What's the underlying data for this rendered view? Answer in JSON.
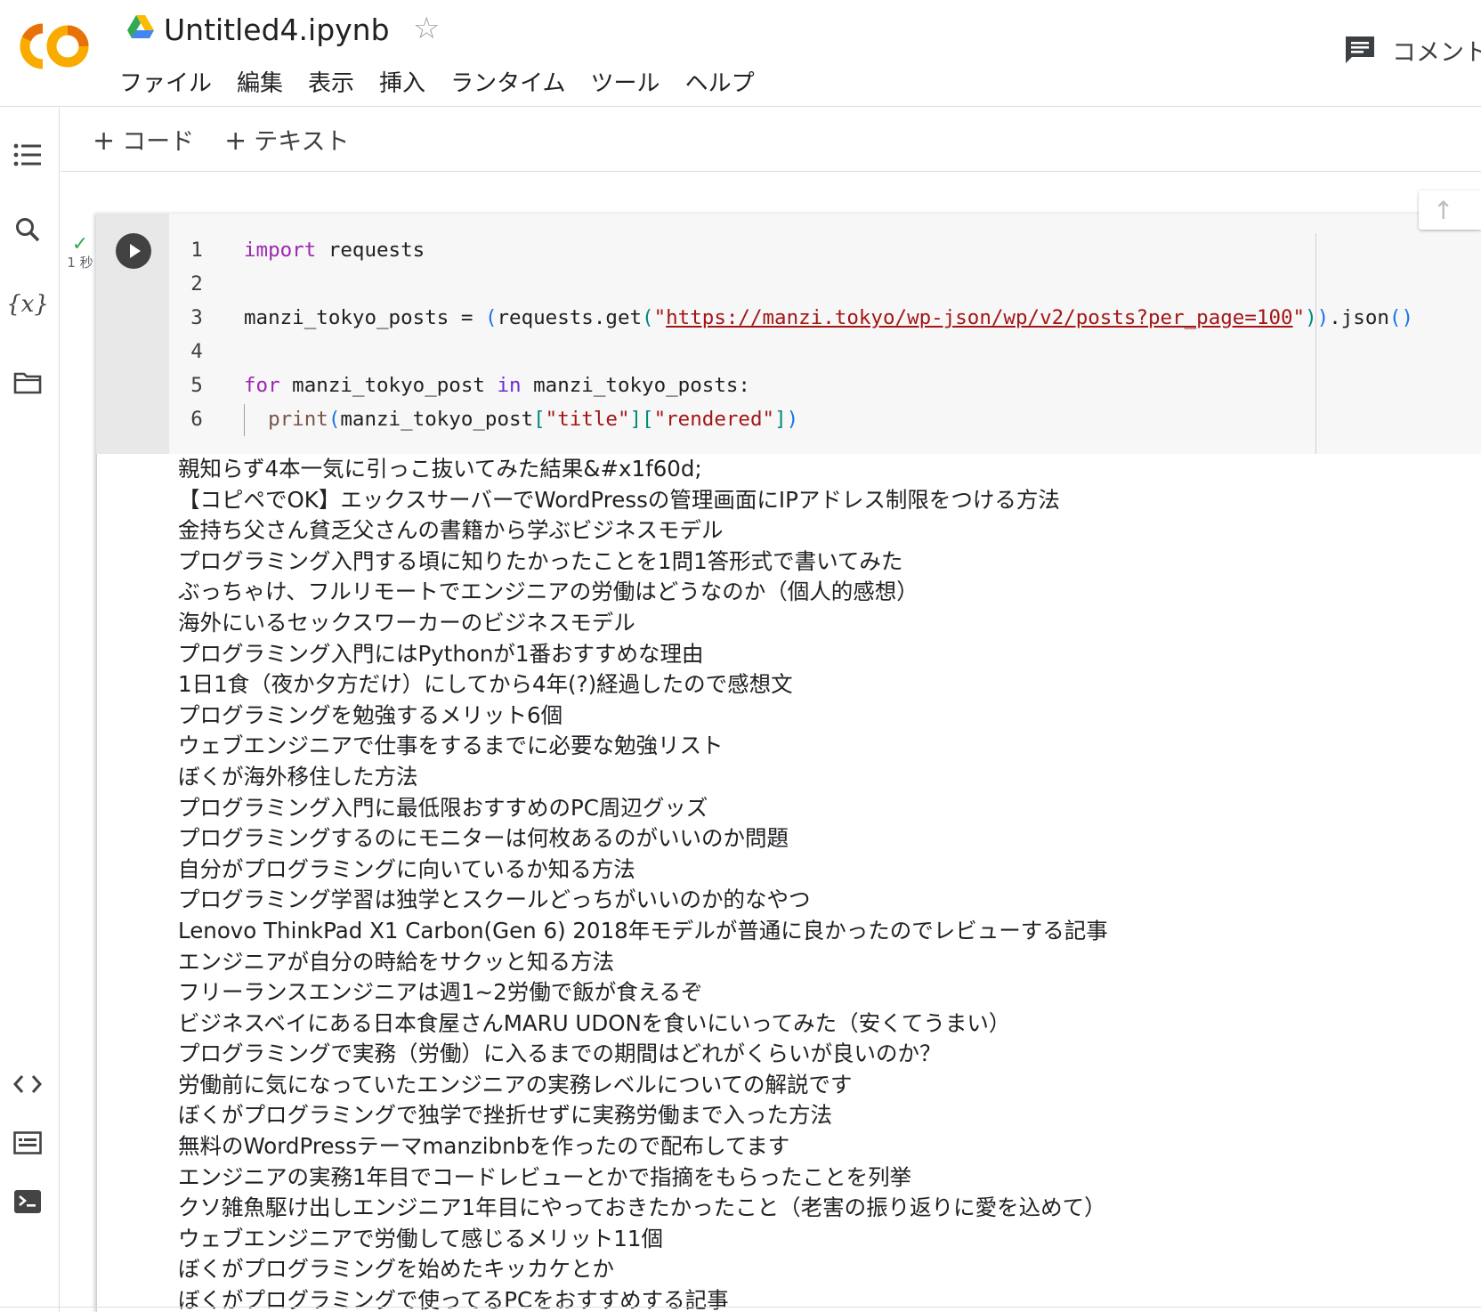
{
  "header": {
    "notebook_title": "Untitled4.ipynb",
    "menu": [
      "ファイル",
      "編集",
      "表示",
      "挿入",
      "ランタイム",
      "ツール",
      "ヘルプ"
    ],
    "comment_label": "コメント"
  },
  "toolbar": {
    "add_code_label": "コード",
    "add_text_label": "テキスト"
  },
  "cell": {
    "status_check": "✓",
    "exec_time": "1 秒",
    "code_lines": [
      {
        "num": "1",
        "text": "import requests"
      },
      {
        "num": "2",
        "text": ""
      },
      {
        "num": "3",
        "text": "manzi_tokyo_posts = (requests.get(\"https://manzi.tokyo/wp-json/wp/v2/posts?per_page=100\")).json()"
      },
      {
        "num": "4",
        "text": ""
      },
      {
        "num": "5",
        "text": "for manzi_tokyo_post in manzi_tokyo_posts:"
      },
      {
        "num": "6",
        "text": "  print(manzi_tokyo_post[\"title\"][\"rendered\"])"
      }
    ],
    "output_lines": [
      "親知らず4本一気に引っこ抜いてみた結果&#x1f60d;",
      "【コピペでOK】エックスサーバーでWordPressの管理画面にIPアドレス制限をつける方法",
      "金持ち父さん貧乏父さんの書籍から学ぶビジネスモデル",
      "プログラミング入門する頃に知りたかったことを1問1答形式で書いてみた",
      "ぶっちゃけ、フルリモートでエンジニアの労働はどうなのか（個人的感想）",
      "海外にいるセックスワーカーのビジネスモデル",
      "プログラミング入門にはPythonが1番おすすめな理由",
      "1日1食（夜か夕方だけ）にしてから4年(?)経過したので感想文",
      "プログラミングを勉強するメリット6個",
      "ウェブエンジニアで仕事をするまでに必要な勉強リスト",
      "ぼくが海外移住した方法",
      "プログラミング入門に最低限おすすめのPC周辺グッズ",
      "プログラミングするのにモニターは何枚あるのがいいのか問題",
      "自分がプログラミングに向いているか知る方法",
      "プログラミング学習は独学とスクールどっちがいいのか的なやつ",
      "Lenovo ThinkPad X1 Carbon(Gen 6) 2018年モデルが普通に良かったのでレビューする記事",
      "エンジニアが自分の時給をサクッと知る方法",
      "フリーランスエンジニアは週1~2労働で飯が食えるぞ",
      "ビジネスベイにある日本食屋さんMARU UDONを食いにいってみた（安くてうまい）",
      "プログラミングで実務（労働）に入るまでの期間はどれがくらいが良いのか？",
      "労働前に気になっていたエンジニアの実務レベルについての解説です",
      "ぼくがプログラミングで独学で挫折せずに実務労働まで入った方法",
      "無料のWordPressテーマmanzibnbを作ったので配布してます",
      "エンジニアの実務1年目でコードレビューとかで指摘をもらったことを列挙",
      "クソ雑魚駆け出しエンジニア1年目にやっておきたかったこと（老害の振り返りに愛を込めて）",
      "ウェブエンジニアで労働して感じるメリット11個",
      "ぼくがプログラミングを始めたキッカケとか",
      "ぼくがプログラミングで使ってるPCをおすすめする記事"
    ]
  },
  "colors": {
    "logo_orange": "#f9ab00",
    "logo_dark_orange": "#e8710a",
    "keyword": "#9c27b0",
    "string": "#a31515",
    "bracket": "#1a73e8",
    "check": "#34a853"
  },
  "icons": {
    "logo": "colab-logo",
    "drive": "google-drive-icon",
    "star": "star-outline-icon",
    "comment": "comment-icon",
    "sidebar": [
      "toc-icon",
      "search-icon",
      "variables-icon",
      "folder-icon",
      "code-snippets-icon",
      "command-palette-icon",
      "terminal-icon"
    ]
  }
}
